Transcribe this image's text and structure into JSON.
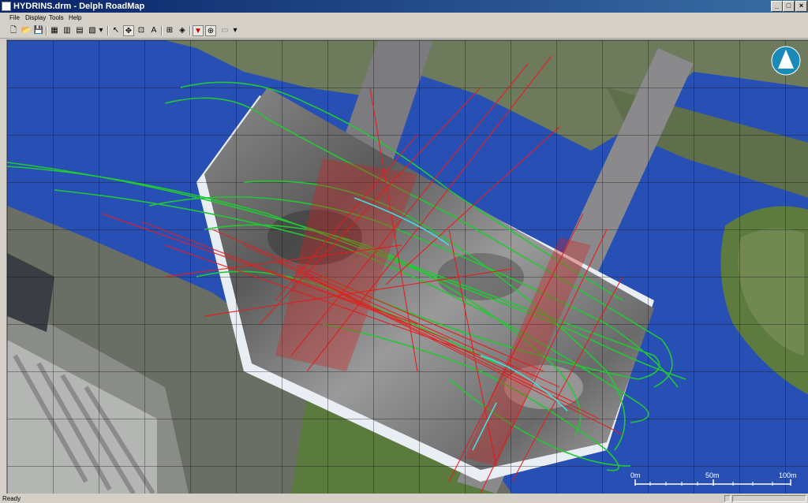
{
  "window": {
    "title": "HYDRINS.drm - Delph RoadMap"
  },
  "window_buttons": {
    "minimize": "_",
    "maximize": "□",
    "close": "×"
  },
  "menu": {
    "file": "File",
    "display": "Display",
    "tools": "Tools",
    "help": "Help"
  },
  "toolbar": {
    "new": "🗋",
    "open": "📂",
    "save": "💾",
    "grid1": "▦",
    "grid2": "▥",
    "grid3": "▤",
    "grid4": "▧",
    "more1": "▾",
    "pointer": "↖",
    "pan": "✥",
    "zoom_box": "⊡",
    "measure": "A",
    "zoom_extent": "⊞",
    "identify": "◈",
    "filter": "▼",
    "target": "⊕",
    "camera": "▭",
    "more2": "▾"
  },
  "map": {
    "compass_icon": "north-arrow",
    "scale": {
      "label_0": "0m",
      "label_50": "50m",
      "label_100": "100m"
    }
  },
  "status": {
    "ready": "Ready"
  },
  "colors": {
    "water": "#2850b4",
    "land": "#6f7f5a",
    "track_green": "#22c833",
    "track_red": "#e81c1c",
    "cyan": "#3fe0e0"
  }
}
